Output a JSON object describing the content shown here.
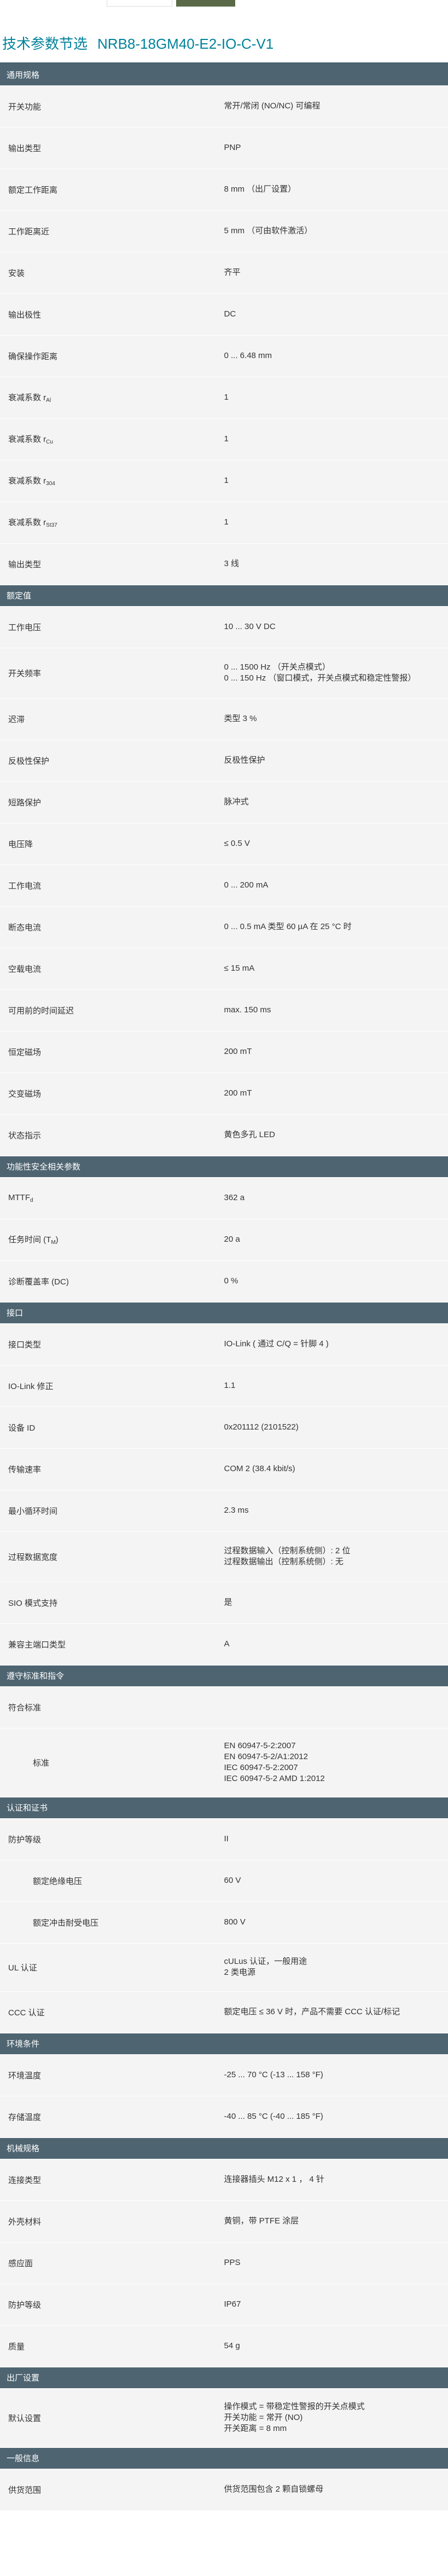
{
  "page": {
    "title": "技术参数节选",
    "product": "NRB8-18GM40-E2-IO-C-V1"
  },
  "sections": [
    {
      "title": "通用规格",
      "rows": [
        {
          "k": "开关功能",
          "v": [
            "常开/常闭 (NO/NC) 可编程"
          ],
          "h": 76
        },
        {
          "k": "输出类型",
          "v": [
            "PNP"
          ],
          "h": 76
        },
        {
          "k": "额定工作距离",
          "v": [
            "8 mm （出厂设置）"
          ],
          "h": 76
        },
        {
          "k": "工作距离近",
          "v": [
            "5 mm （可由软件激活）"
          ],
          "h": 76
        },
        {
          "k": "安装",
          "v": [
            "齐平"
          ],
          "h": 76
        },
        {
          "k": "输出极性",
          "v": [
            "DC"
          ],
          "h": 76
        },
        {
          "k": "确保操作距离",
          "v": [
            "0 ... 6.48 mm"
          ],
          "h": 76
        },
        {
          "k": "衰减系数 r",
          "sub": "Al",
          "v": [
            "1"
          ],
          "h": 76
        },
        {
          "k": "衰减系数 r",
          "sub": "Cu",
          "v": [
            "1"
          ],
          "h": 76
        },
        {
          "k": "衰减系数 r",
          "sub": "304",
          "v": [
            "1"
          ],
          "h": 76
        },
        {
          "k": "衰减系数 r",
          "sub": "St37",
          "v": [
            "1"
          ],
          "h": 76
        },
        {
          "k": "输出类型",
          "v": [
            "3 线"
          ],
          "h": 76
        }
      ]
    },
    {
      "title": "额定值",
      "rows": [
        {
          "k": "工作电压",
          "v": [
            "10 ... 30 V DC"
          ],
          "h": 76
        },
        {
          "k": "开关频率",
          "v": [
            "0 ... 1500 Hz （开关点模式）",
            "0 ... 150 Hz （窗口模式，开关点模式和稳定性警报）"
          ],
          "h": 92
        },
        {
          "k": "迟滞",
          "v": [
            "类型 3 %"
          ],
          "h": 76
        },
        {
          "k": "反极性保护",
          "v": [
            "反极性保护"
          ],
          "h": 76
        },
        {
          "k": "短路保护",
          "v": [
            "脉冲式"
          ],
          "h": 76
        },
        {
          "k": "电压降",
          "v": [
            "≤ 0.5 V"
          ],
          "h": 76
        },
        {
          "k": "工作电流",
          "v": [
            "0 ... 200 mA"
          ],
          "h": 76
        },
        {
          "k": "断态电流",
          "v": [
            "0 ... 0.5 mA 类型 60 µA 在 25 °C 时"
          ],
          "h": 76
        },
        {
          "k": "空载电流",
          "v": [
            "≤ 15 mA"
          ],
          "h": 76
        },
        {
          "k": "可用前的时间延迟",
          "v": [
            "max. 150 ms"
          ],
          "h": 76
        },
        {
          "k": "恒定磁场",
          "v": [
            "200 mT"
          ],
          "h": 76
        },
        {
          "k": "交变磁场",
          "v": [
            "200 mT"
          ],
          "h": 76
        },
        {
          "k": "状态指示",
          "v": [
            "黄色多孔 LED"
          ],
          "h": 76
        }
      ]
    },
    {
      "title": "功能性安全相关参数",
      "rows": [
        {
          "k": "MTTF",
          "sub": "d",
          "v": [
            "362 a"
          ],
          "h": 76
        },
        {
          "k": "任务时间 (T",
          "sub": "M",
          "tail": ")",
          "v": [
            "20 a"
          ],
          "h": 76
        },
        {
          "k": "诊断覆盖率 (DC)",
          "v": [
            "0 %"
          ],
          "h": 76
        }
      ]
    },
    {
      "title": "接口",
      "rows": [
        {
          "k": "接口类型",
          "v": [
            "IO-Link ( 通过 C/Q = 针脚 4 )"
          ],
          "h": 76
        },
        {
          "k": "IO-Link 修正",
          "v": [
            "1.1"
          ],
          "h": 76
        },
        {
          "k": "设备 ID",
          "v": [
            "0x201112 (2101522)"
          ],
          "h": 76
        },
        {
          "k": "传输速率",
          "v": [
            "COM 2 (38.4 kbit/s)"
          ],
          "h": 76
        },
        {
          "k": "最小循环时间",
          "v": [
            "2.3 ms"
          ],
          "h": 76
        },
        {
          "k": "过程数据宽度",
          "v": [
            "过程数据输入（控制系统侧）: 2 位",
            "过程数据输出（控制系统侧）: 无"
          ],
          "h": 92
        },
        {
          "k": "SIO 模式支持",
          "v": [
            "是"
          ],
          "h": 76
        },
        {
          "k": "兼容主端口类型",
          "v": [
            "A"
          ],
          "h": 76
        }
      ]
    },
    {
      "title": "遵守标准和指令",
      "rows": [
        {
          "k": "符合标准",
          "v": [
            ""
          ],
          "h": 76
        },
        {
          "k": "标准",
          "indent": true,
          "v": [
            "EN 60947-5-2:2007",
            "EN 60947-5-2/A1:2012",
            "IEC 60947-5-2:2007",
            "IEC 60947-5-2 AMD 1:2012"
          ],
          "h": 126
        }
      ]
    },
    {
      "title": "认证和证书",
      "rows": [
        {
          "k": "防护等级",
          "v": [
            "II"
          ],
          "h": 76
        },
        {
          "k": "额定绝缘电压",
          "indent": true,
          "v": [
            "60 V"
          ],
          "h": 76
        },
        {
          "k": "额定冲击耐受电压",
          "indent": true,
          "v": [
            "800 V"
          ],
          "h": 76
        },
        {
          "k": "UL 认证",
          "v": [
            "cULus 认证，一般用途",
            "2 类电源"
          ],
          "h": 88
        },
        {
          "k": "CCC 认证",
          "v": [
            "额定电压 ≤ 36 V 时，产品不需要 CCC 认证/标记"
          ],
          "h": 76
        }
      ]
    },
    {
      "title": "环境条件",
      "rows": [
        {
          "k": "环境温度",
          "v": [
            "-25 ... 70 °C (-13 ... 158 °F)"
          ],
          "h": 76
        },
        {
          "k": "存储温度",
          "v": [
            "-40 ... 85 °C (-40 ... 185 °F)"
          ],
          "h": 76
        }
      ]
    },
    {
      "title": "机械规格",
      "rows": [
        {
          "k": "连接类型",
          "v": [
            "连接器插头 M12 x 1 ， 4 针"
          ],
          "h": 76
        },
        {
          "k": "外壳材料",
          "v": [
            "黄铜，带 PTFE 涂层"
          ],
          "h": 76
        },
        {
          "k": "感应面",
          "v": [
            "PPS"
          ],
          "h": 76
        },
        {
          "k": "防护等级",
          "v": [
            "IP67"
          ],
          "h": 76
        },
        {
          "k": "质量",
          "v": [
            "54 g"
          ],
          "h": 76
        }
      ]
    },
    {
      "title": "出厂设置",
      "rows": [
        {
          "k": "默认设置",
          "v": [
            "操作模式 = 带稳定性警报的开关点模式",
            "开关功能 = 常开 (NO)",
            "开关距离 = 8 mm"
          ],
          "h": 108
        }
      ]
    },
    {
      "title": "一般信息",
      "rows": [
        {
          "k": "供货范围",
          "v": [
            "供货范围包含 2 颗自锁螺母"
          ],
          "h": 76
        }
      ]
    }
  ]
}
